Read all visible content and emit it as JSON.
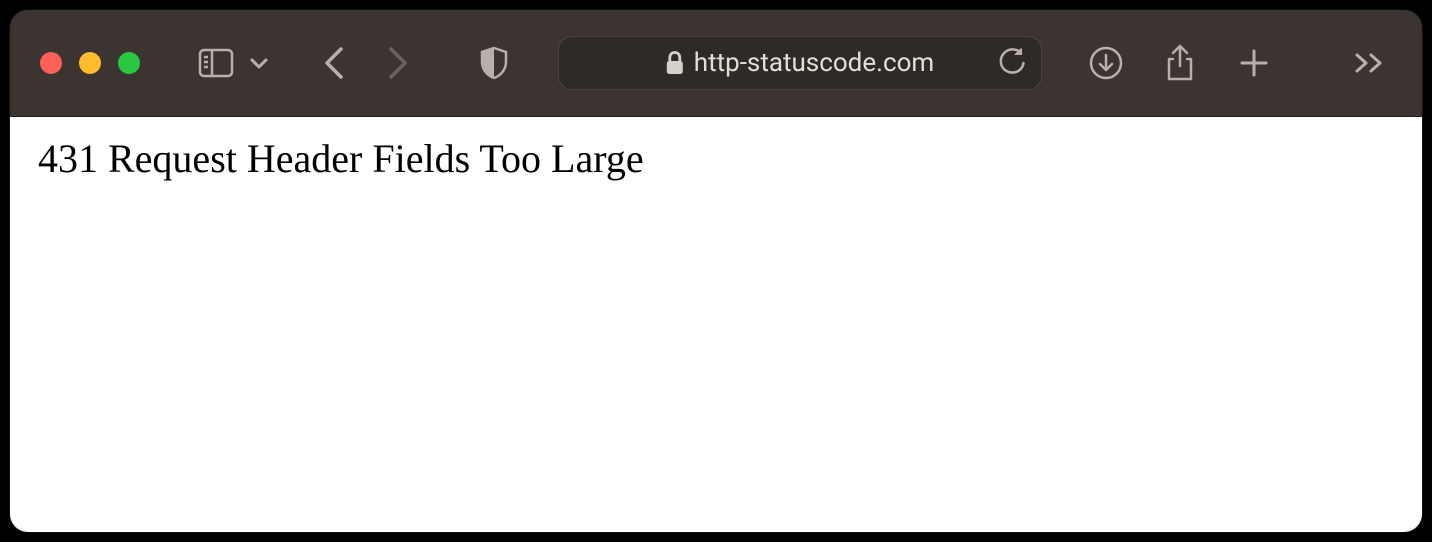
{
  "address_bar": {
    "url_display": "http-statuscode.com"
  },
  "content": {
    "status_message": "431 Request Header Fields Too Large"
  },
  "icons": {
    "sidebar": "sidebar-icon",
    "chevron_down": "chevron-down-icon",
    "back": "back-icon",
    "forward": "forward-icon",
    "shield": "privacy-shield-icon",
    "lock": "lock-icon",
    "reload": "reload-icon",
    "downloads": "downloads-icon",
    "share": "share-icon",
    "new_tab": "new-tab-icon",
    "overflow": "overflow-icon"
  }
}
